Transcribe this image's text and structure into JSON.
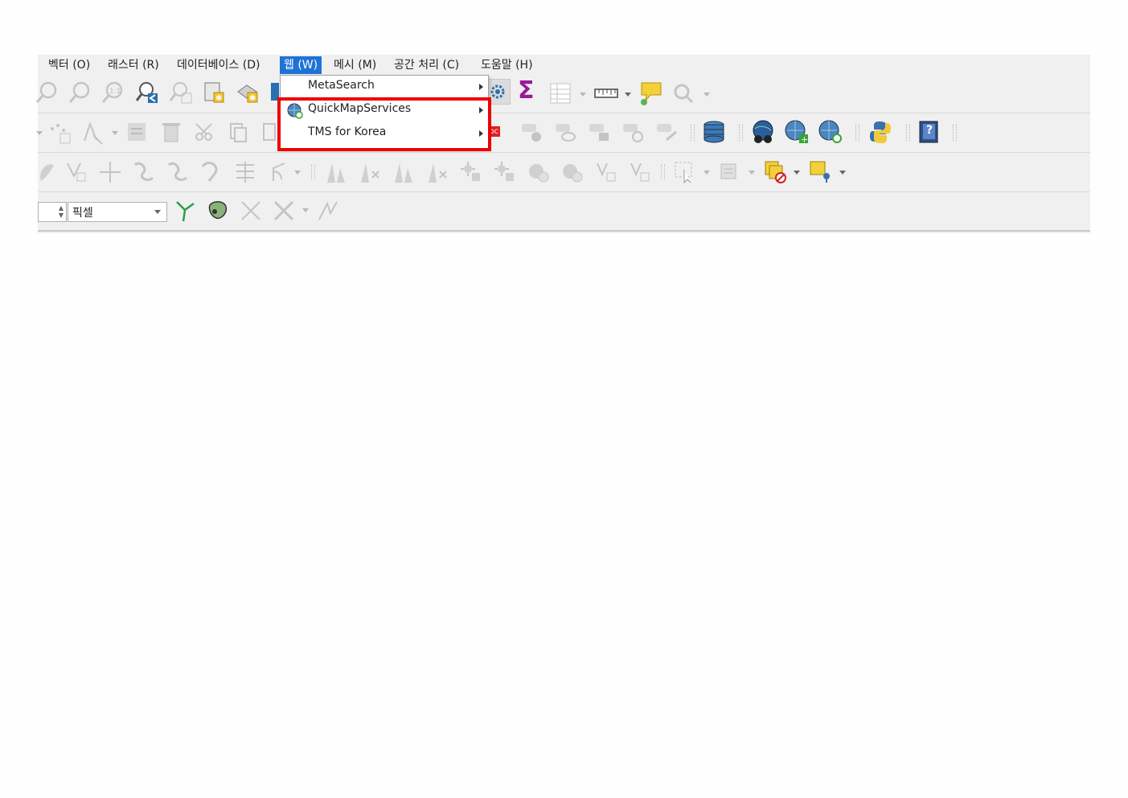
{
  "menubar": {
    "items": [
      {
        "label": "벡터 (O)"
      },
      {
        "label": "래스터 (R)"
      },
      {
        "label": "데이터베이스 (D)"
      },
      {
        "label": "웹 (W)"
      },
      {
        "label": "메시 (M)"
      },
      {
        "label": "공간 처리 (C)"
      },
      {
        "label": "도움말 (H)"
      }
    ],
    "active": "웹 (W)"
  },
  "web_menu": {
    "items": [
      {
        "label": "MetaSearch",
        "has_submenu": true,
        "icon": "none"
      },
      {
        "label": "QuickMapServices",
        "has_submenu": true,
        "icon": "quickmapservices-icon"
      },
      {
        "label": "TMS for Korea",
        "has_submenu": true,
        "icon": "none"
      }
    ],
    "highlight_color": "#ee0000"
  },
  "toolbar": {
    "unit_combo_value": "픽셀",
    "sum_symbol": "Σ",
    "label_icon_text": "abc",
    "help_icon_text": "?"
  },
  "colors": {
    "menu_active": "#1e73d6",
    "sum_icon": "#9a1a9a",
    "highlight_box": "#ee0000",
    "comment_icon": "#f3d03a"
  }
}
